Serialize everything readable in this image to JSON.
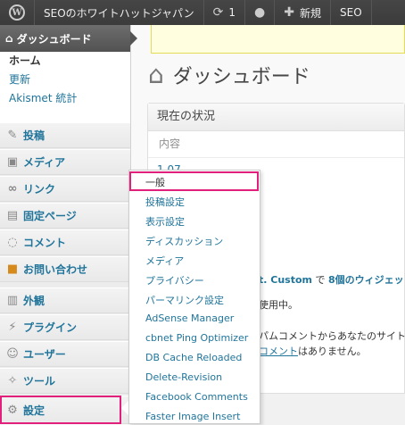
{
  "adminbar": {
    "logo": "W",
    "site_name": "SEOのホワイトハットジャパン",
    "updates_count": "1",
    "new_label": "新規",
    "seo_label": "SEO"
  },
  "menu": {
    "dashboard": "ダッシュボード",
    "submenu": [
      "ホーム",
      "更新",
      "Akismet 統計"
    ],
    "items": [
      "投稿",
      "メディア",
      "リンク",
      "固定ページ",
      "コメント",
      "お問い合わせ",
      "外観",
      "プラグイン",
      "ユーザー",
      "ツール",
      "設定"
    ]
  },
  "main": {
    "page_title": "ダッシュボード",
    "box_title": "現在の状況",
    "content_label": "内容",
    "partial_row": "1,07",
    "theme_prefix": "t. Custom",
    "theme_mid": " で ",
    "theme_widgets": "8個のウィジェッ",
    "line2": "使用中。",
    "line3": "パムコメントからあなたのサイト",
    "line4_link": "コメント",
    "line4_text": "はありません。"
  },
  "flyout": {
    "items": [
      "一般",
      "投稿設定",
      "表示設定",
      "ディスカッション",
      "メディア",
      "プライバシー",
      "パーマリンク設定",
      "AdSense Manager",
      "cbnet Ping Optimizer",
      "DB Cache Reloaded",
      "Delete-Revision",
      "Facebook Comments",
      "Faster Image Insert"
    ]
  },
  "colors": {
    "highlight": "#e0207a",
    "link": "#21759b",
    "adminbar": "#464646"
  },
  "icons": [
    "wordpress-logo-icon",
    "refresh-icon",
    "comment-bubble-icon",
    "plus-icon",
    "home-icon",
    "house-icon"
  ]
}
